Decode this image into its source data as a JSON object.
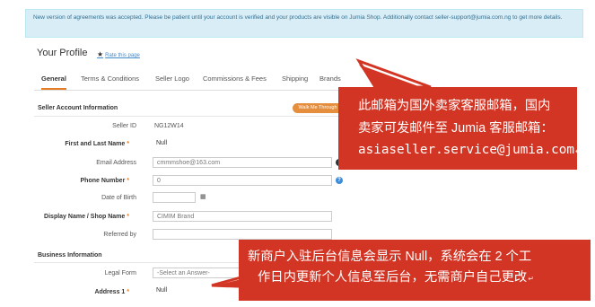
{
  "notice": {
    "text": "New version of agreements was accepted. Please be patient until your account is verified and your products are visible on Jumia Shop. Additionally contact seller-support@jumia.com.ng to get more details."
  },
  "profile": {
    "title": "Your Profile",
    "rate_link": "Rate this page"
  },
  "tabs": [
    "General",
    "Terms & Conditions",
    "Seller Logo",
    "Commissions & Fees",
    "Shipping",
    "Brands"
  ],
  "sections": {
    "seller_account": "Seller Account Information",
    "business": "Business Information"
  },
  "walk_button": "Walk Me Through",
  "fields": {
    "seller_id": {
      "label": "Seller ID",
      "value": "NG12W14"
    },
    "name": {
      "label": "First and Last Name",
      "value": "Null"
    },
    "email": {
      "label": "Email Address",
      "value": "cmmmshoe@163.com"
    },
    "phone": {
      "label": "Phone Number",
      "value": "0"
    },
    "dob": {
      "label": "Date of Birth",
      "value": ""
    },
    "display_name": {
      "label": "Display Name / Shop Name",
      "value": "CIMIM Brand"
    },
    "referred_by": {
      "label": "Referred by",
      "value": ""
    },
    "legal_form": {
      "label": "Legal Form",
      "value": "-Select an Answer-"
    },
    "address": {
      "label": "Address 1",
      "value": "Null"
    }
  },
  "callouts": {
    "c1_line1": "此邮箱为国外卖家客服邮箱，国内",
    "c1_line2": "卖家可发邮件至 Jumia 客服邮箱：",
    "c1_line3": "asiaseller.service@jumia.com",
    "c2_line1": "新商户入驻后台信息会显示 Null，系统会在 2 个工",
    "c2_line2": "作日内更新个人信息至后台，无需商户自己更改",
    "return_mark": "↵"
  },
  "colors": {
    "callout_bg": "#d33524",
    "notice_bg": "#d9edf7",
    "accent": "#e57c25"
  }
}
